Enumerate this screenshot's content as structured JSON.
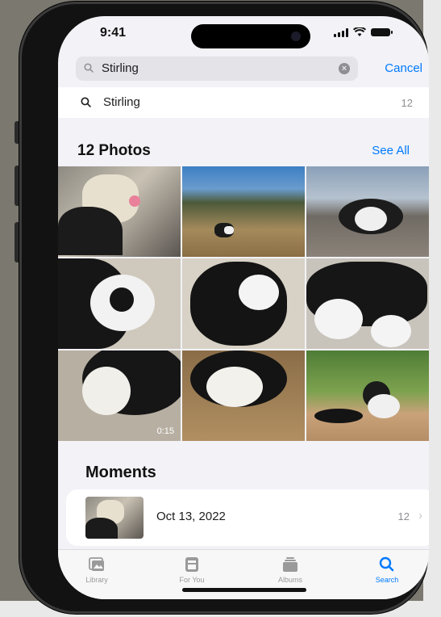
{
  "status_bar": {
    "time": "9:41"
  },
  "search": {
    "value": "Stirling",
    "cancel_label": "Cancel"
  },
  "suggestion": {
    "label": "Stirling",
    "count": "12"
  },
  "photos_section": {
    "title": "12 Photos",
    "see_all_label": "See All",
    "video_duration": "0:15"
  },
  "moments_section": {
    "title": "Moments",
    "item": {
      "date": "Oct 13, 2022",
      "count": "12"
    }
  },
  "tab_bar": {
    "items": [
      {
        "label": "Library",
        "icon": "photo-library-icon",
        "active": false
      },
      {
        "label": "For You",
        "icon": "for-you-icon",
        "active": false
      },
      {
        "label": "Albums",
        "icon": "albums-icon",
        "active": false
      },
      {
        "label": "Search",
        "icon": "search-icon",
        "active": true
      }
    ]
  },
  "colors": {
    "accent": "#007aff",
    "background": "#f2f2f7",
    "secondary_text": "#8e8e93"
  }
}
